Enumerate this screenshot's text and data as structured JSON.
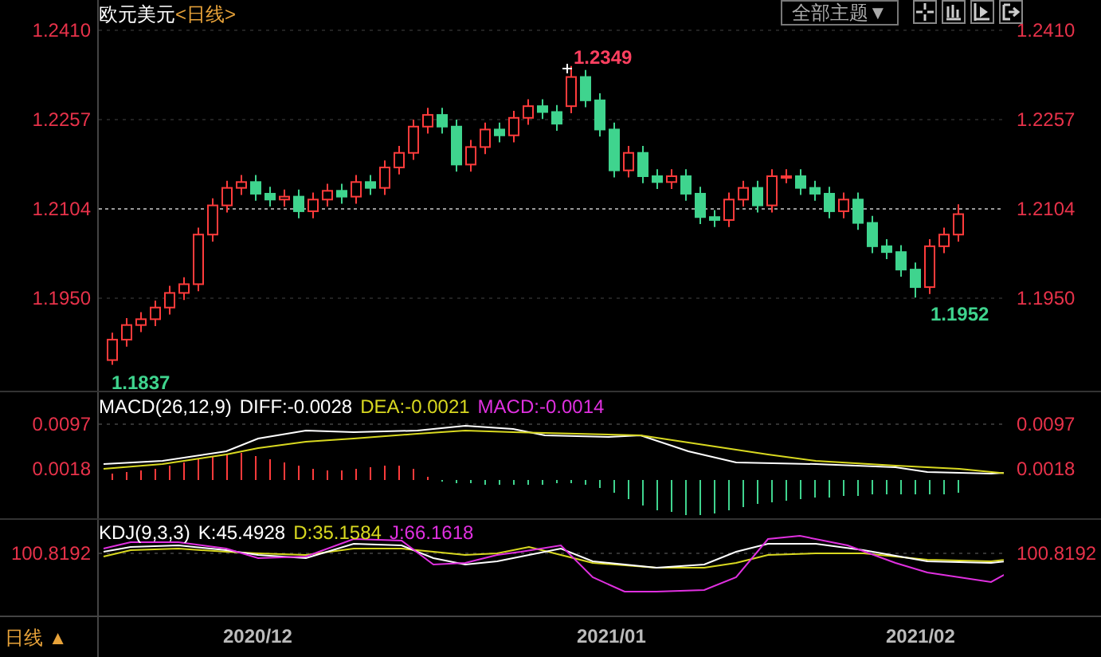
{
  "header": {
    "title": "欧元美元",
    "period": "<日线>",
    "theme_button": "全部主题▼"
  },
  "price_panel": {
    "left_axis_labels": [
      "1.2410",
      "1.2257",
      "1.2104",
      "1.1950"
    ],
    "right_axis_labels": [
      "1.2410",
      "1.2257",
      "1.2104",
      "1.1950"
    ],
    "high_label": "1.2349",
    "start_low_label": "1.1837",
    "recent_low_label": "1.1952"
  },
  "macd_panel": {
    "legend": [
      {
        "text": "MACD(26,12,9)",
        "color": "#ffffff"
      },
      {
        "text": "DIFF:-0.0028",
        "color": "#ffffff"
      },
      {
        "text": "DEA:-0.0021",
        "color": "#d8d820"
      },
      {
        "text": "MACD:-0.0014",
        "color": "#e030e0"
      }
    ],
    "left_axis_labels": [
      "0.0097",
      "0.0018"
    ],
    "right_axis_labels": [
      "0.0097",
      "0.0018"
    ]
  },
  "kdj_panel": {
    "legend": [
      {
        "text": "KDJ(9,3,3)",
        "color": "#ffffff"
      },
      {
        "text": "K:45.4928",
        "color": "#ffffff"
      },
      {
        "text": "D:35.1584",
        "color": "#d8d820"
      },
      {
        "text": "J:66.1618",
        "color": "#e030e0"
      }
    ],
    "left_axis_labels": [
      "100.8192"
    ],
    "right_axis_labels": [
      "100.8192"
    ]
  },
  "footer": {
    "period_button": "日线 ▲",
    "dates": [
      "2020/12",
      "2021/01",
      "2021/02"
    ]
  }
}
